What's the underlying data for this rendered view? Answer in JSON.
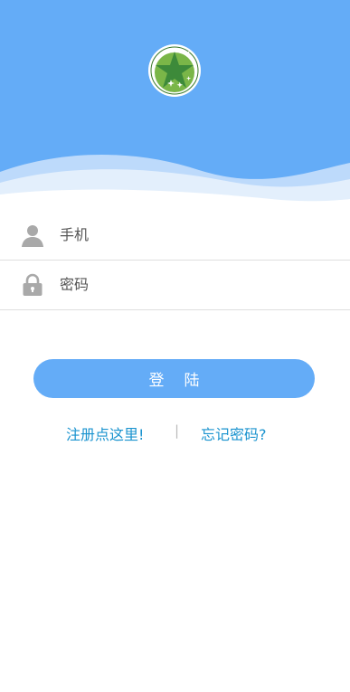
{
  "login_form": {
    "phone": {
      "placeholder": "手机",
      "value": ""
    },
    "password": {
      "placeholder": "密码",
      "value": ""
    },
    "submit_label": "登陆"
  },
  "links": {
    "register": "注册点这里!",
    "separator": "|",
    "forgot_password": "忘记密码?"
  },
  "colors": {
    "header_blue": "#64acf7",
    "button_blue": "#64acf7",
    "link_teal": "#1a93cf",
    "logo_green": "#7ab648"
  },
  "icons": {
    "logo": "star-logo-icon",
    "phone": "user-icon",
    "password": "lock-icon"
  }
}
